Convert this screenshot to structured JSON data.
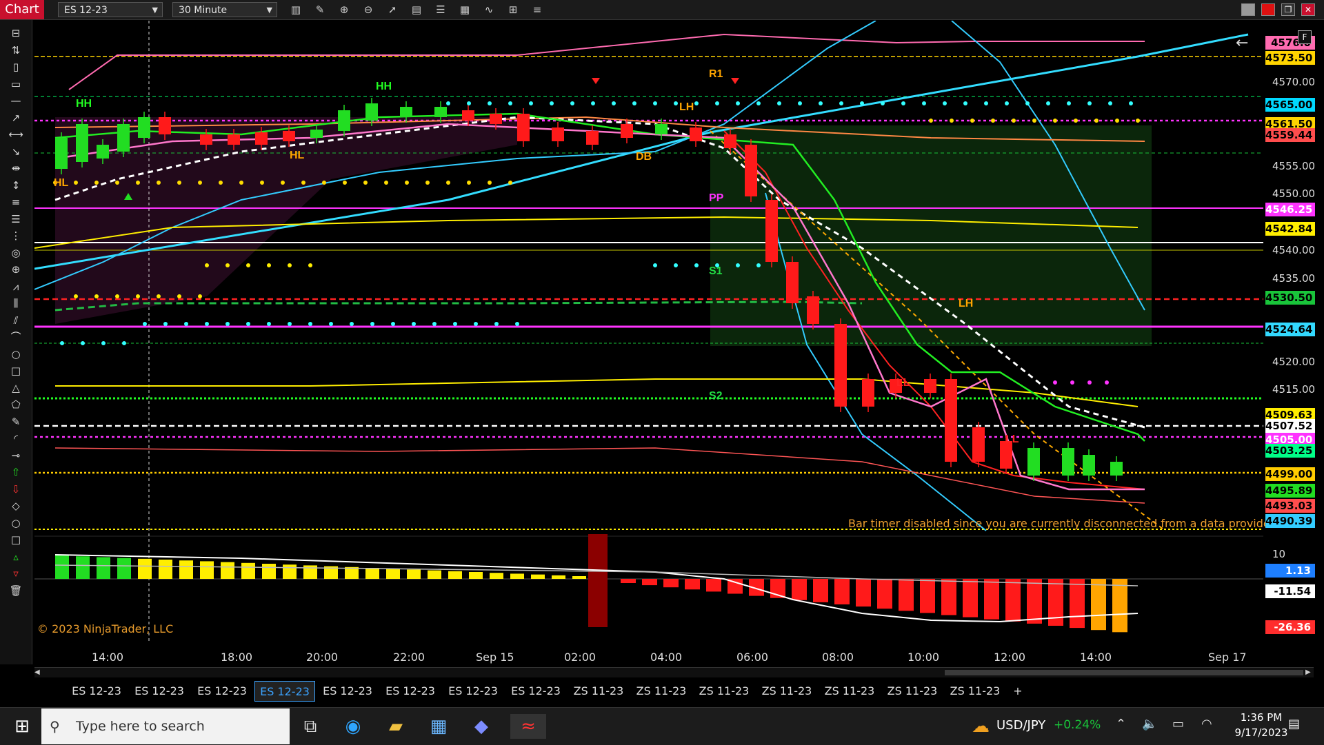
{
  "app": {
    "title": "Chart"
  },
  "toolbar": {
    "instrument": "ES 12-23",
    "interval": "30 Minute",
    "icons": [
      "bar-type-icon",
      "draw-pencil-icon",
      "zoom-in-icon",
      "zoom-out-icon",
      "pointer-icon",
      "properties-icon",
      "templates-icon",
      "strategies-icon",
      "indicators-icon",
      "calculator-icon",
      "list-icon"
    ]
  },
  "window_buttons": [
    "minimize-icon",
    "maximize-icon",
    "restore-icon",
    "close-icon"
  ],
  "left_tools": [
    "ruler-icon",
    "risk-reward-icon",
    "region-icon",
    "rectangle-icon",
    "line-icon",
    "ray-icon",
    "extended-line-icon",
    "arrow-line-icon",
    "horizontal-line-icon",
    "vertical-line-icon",
    "fib-retracement-icon",
    "fib-extension-icon",
    "time-fib-icon",
    "fib-circle-icon",
    "gann-fan-icon",
    "andrews-pitchfork-icon",
    "regression-channel-icon",
    "trend-channel-icon",
    "arc-icon",
    "ellipse-icon",
    "rectangle-shape-icon",
    "triangle-icon",
    "polygon-icon",
    "text-icon",
    "arc-line-icon",
    "path-icon",
    "arrow-up-icon",
    "arrow-down-icon",
    "diamond-icon",
    "dot-icon",
    "square-icon",
    "triangle-up-icon",
    "triangle-down-icon",
    "trash-icon"
  ],
  "chart": {
    "price_ticks": [
      "4570.00",
      "4555.00",
      "4550.00",
      "4540.00",
      "4535.00",
      "4520.00",
      "4515.00"
    ],
    "level_badges": [
      {
        "label": "4576.0",
        "bg": "#ff6bb0",
        "fg": "#000"
      },
      {
        "label": "4573.50",
        "bg": "#ffd400",
        "fg": "#000"
      },
      {
        "label": "4565.00",
        "bg": "#00d9ff",
        "fg": "#000"
      },
      {
        "label": "4561.50",
        "bg": "#ffd400",
        "fg": "#000"
      },
      {
        "label": "4559.44",
        "bg": "#ff4d4d",
        "fg": "#000"
      },
      {
        "label": "4546.25",
        "bg": "#ff33ff",
        "fg": "#fff"
      },
      {
        "label": "4542.84",
        "bg": "#ffee00",
        "fg": "#000"
      },
      {
        "label": "4530.50",
        "bg": "#19c43a",
        "fg": "#000"
      },
      {
        "label": "4524.64",
        "bg": "#33d9ff",
        "fg": "#000"
      },
      {
        "label": "4509.63",
        "bg": "#ffee00",
        "fg": "#000"
      },
      {
        "label": "4507.52",
        "bg": "#ffffff",
        "fg": "#000"
      },
      {
        "label": "4505.00",
        "bg": "#ff33ff",
        "fg": "#fff"
      },
      {
        "label": "4503.25",
        "bg": "#00ff88",
        "fg": "#000"
      },
      {
        "label": "4499.00",
        "bg": "#ffcc00",
        "fg": "#000"
      },
      {
        "label": "4495.89",
        "bg": "#22dd22",
        "fg": "#000"
      },
      {
        "label": "4493.03",
        "bg": "#ff4d4d",
        "fg": "#000"
      },
      {
        "label": "4490.39",
        "bg": "#33ccff",
        "fg": "#000"
      }
    ],
    "time_labels": [
      "14:00",
      "18:00",
      "20:00",
      "22:00",
      "Sep 15",
      "02:00",
      "04:00",
      "06:00",
      "08:00",
      "10:00",
      "12:00",
      "14:00",
      "Sep 17"
    ],
    "annotations": [
      "HH",
      "HH",
      "HL",
      "HL",
      "LH",
      "DB",
      "R1",
      "PP",
      "S1",
      "LH",
      "S2",
      "LL",
      "LL"
    ],
    "bar_timer_text": "Bar timer disabled since you are currently disconnected from a data provider",
    "copyright": "© 2023 NinjaTrader, LLC",
    "indicator_panel": {
      "axis_label": "10",
      "badges": [
        {
          "label": "1.13",
          "bg": "#1e7fff",
          "fg": "#fff"
        },
        {
          "label": "-11.54",
          "bg": "#ffffff",
          "fg": "#000"
        },
        {
          "label": "-26.36",
          "bg": "#ff2d2d",
          "fg": "#fff"
        }
      ]
    },
    "colors": {
      "up_candle": "#22dd22",
      "down_candle": "#ff1a1a",
      "cyan": "#33ccff",
      "pink": "#ff6bb0",
      "yellow": "#ffee00",
      "magenta": "#ff33ff"
    }
  },
  "tabs": [
    "ES 12-23",
    "ES 12-23",
    "ES 12-23",
    "ES 12-23",
    "ES 12-23",
    "ES 12-23",
    "ES 12-23",
    "ES 12-23",
    "ZS 11-23",
    "ZS 11-23",
    "ZS 11-23",
    "ZS 11-23",
    "ZS 11-23",
    "ZS 11-23",
    "ZS 11-23",
    "+"
  ],
  "active_tab_index": 3,
  "taskbar": {
    "search_placeholder": "Type here to search",
    "ticker": "USD/JPY",
    "ticker_change": "+0.24%",
    "time": "1:36 PM",
    "date": "9/17/2023"
  }
}
